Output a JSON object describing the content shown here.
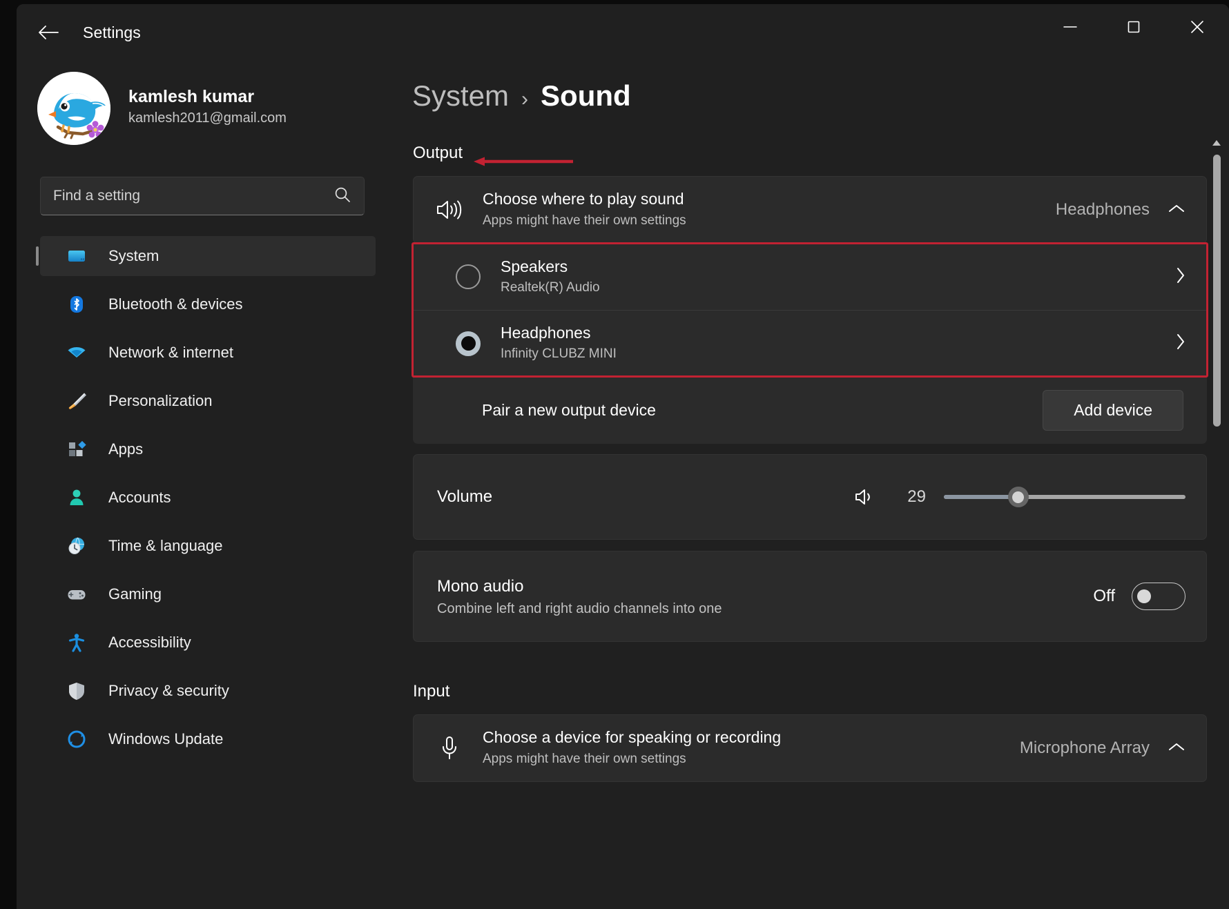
{
  "window": {
    "app_title": "Settings",
    "back_icon": "back-arrow-icon",
    "controls": {
      "minimize": "minimize-icon",
      "maximize": "maximize-icon",
      "close": "close-icon"
    }
  },
  "sidebar": {
    "account": {
      "name": "kamlesh kumar",
      "email": "kamlesh2011@gmail.com",
      "avatar_icon": "bird-avatar"
    },
    "search": {
      "placeholder": "Find a setting",
      "value": "",
      "icon": "search-icon"
    },
    "items": [
      {
        "label": "System",
        "icon": "monitor-icon",
        "selected": true
      },
      {
        "label": "Bluetooth & devices",
        "icon": "bluetooth-icon",
        "selected": false
      },
      {
        "label": "Network & internet",
        "icon": "wifi-icon",
        "selected": false
      },
      {
        "label": "Personalization",
        "icon": "paintbrush-icon",
        "selected": false
      },
      {
        "label": "Apps",
        "icon": "apps-icon",
        "selected": false
      },
      {
        "label": "Accounts",
        "icon": "person-icon",
        "selected": false
      },
      {
        "label": "Time & language",
        "icon": "clock-globe-icon",
        "selected": false
      },
      {
        "label": "Gaming",
        "icon": "gamepad-icon",
        "selected": false
      },
      {
        "label": "Accessibility",
        "icon": "accessibility-icon",
        "selected": false
      },
      {
        "label": "Privacy & security",
        "icon": "shield-icon",
        "selected": false
      },
      {
        "label": "Windows Update",
        "icon": "update-icon",
        "selected": false
      }
    ]
  },
  "breadcrumb": {
    "root": "System",
    "separator": "›",
    "current": "Sound"
  },
  "output": {
    "section_label": "Output",
    "annotation_color": "#c22232",
    "choose": {
      "title": "Choose where to play sound",
      "subtitle": "Apps might have their own settings",
      "value": "Headphones",
      "icon": "speaker-icon",
      "chevron": "chevron-up-icon"
    },
    "devices": [
      {
        "name": "Speakers",
        "sub": "Realtek(R) Audio",
        "selected": false,
        "chevron": "chevron-right-icon"
      },
      {
        "name": "Headphones",
        "sub": "Infinity CLUBZ MINI",
        "selected": true,
        "chevron": "chevron-right-icon"
      }
    ],
    "pair": {
      "label": "Pair a new output device",
      "button": "Add device"
    },
    "volume": {
      "label": "Volume",
      "value": "29",
      "percent": 29,
      "icon": "volume-icon"
    },
    "mono": {
      "title": "Mono audio",
      "subtitle": "Combine left and right audio channels into one",
      "state": "Off",
      "on": false
    }
  },
  "input": {
    "section_label": "Input",
    "choose": {
      "title": "Choose a device for speaking or recording",
      "subtitle": "Apps might have their own settings",
      "value": "Microphone Array",
      "icon": "microphone-icon",
      "chevron": "chevron-up-icon"
    }
  },
  "scrollbar": {
    "up_icon": "scroll-up-arrow-icon"
  }
}
